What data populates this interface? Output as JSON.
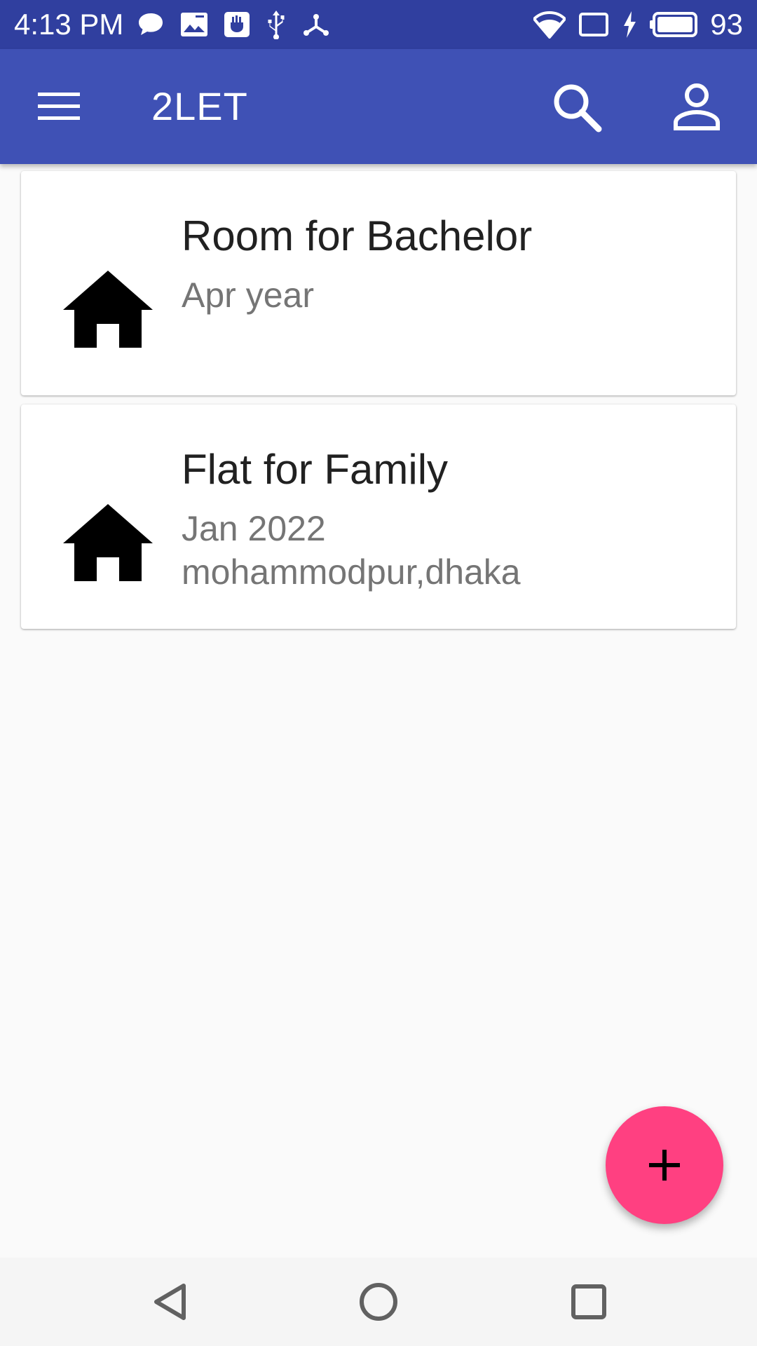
{
  "status_bar": {
    "time": "4:13 PM",
    "battery_percent": "93",
    "left_icons": [
      "chat-bubble-icon",
      "image-icon",
      "keyboard-app-icon",
      "usb-icon",
      "usb-tether-icon"
    ],
    "right_icons": [
      "wifi-icon",
      "cast-icon",
      "charging-icon",
      "battery-icon"
    ]
  },
  "app_bar": {
    "title": "2LET",
    "color": "#3f51b5",
    "status_color": "#303f9f",
    "icons": {
      "menu": "menu-icon",
      "search": "search-icon",
      "account": "account-icon"
    }
  },
  "listings": [
    {
      "icon": "home-icon",
      "title": "Room for Bachelor",
      "date": "Apr year",
      "address": ""
    },
    {
      "icon": "home-icon",
      "title": "Flat for Family",
      "date": "Jan 2022",
      "address": "mohammodpur,dhaka"
    }
  ],
  "fab": {
    "icon": "plus-icon",
    "color": "#ff4081"
  },
  "nav_bar": {
    "icons": [
      "back-icon",
      "home-circle-icon",
      "recents-icon"
    ]
  }
}
